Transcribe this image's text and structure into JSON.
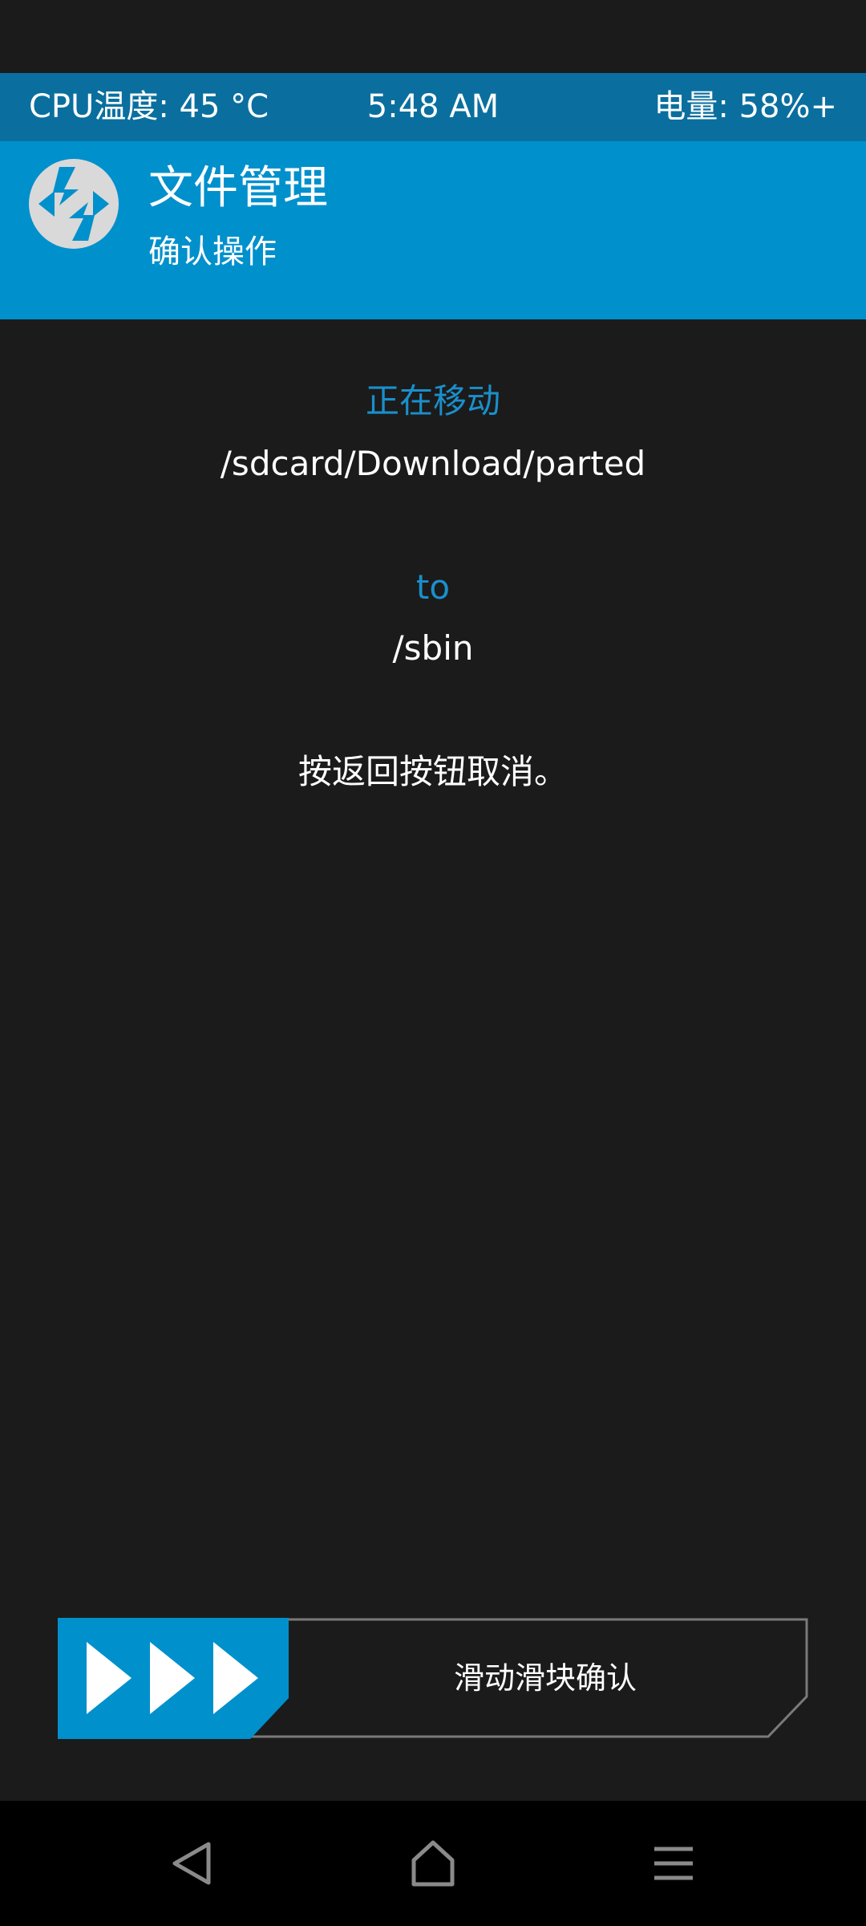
{
  "status_bar": {
    "cpu": "CPU温度: 45 °C",
    "time": "5:48 AM",
    "battery": "电量: 58%+"
  },
  "header": {
    "title": "文件管理",
    "subtitle": "确认操作",
    "logo_icon": "twrp-logo-icon"
  },
  "content": {
    "action_label": "正在移动",
    "source_path": "/sdcard/Download/parted",
    "to_label": "to",
    "dest_path": "/sbin",
    "cancel_hint": "按返回按钮取消。"
  },
  "slider": {
    "label": "滑动滑块确认",
    "handle_icon": "triple-arrow-right-icon"
  },
  "navbar": {
    "back_icon": "back-triangle-icon",
    "home_icon": "home-icon",
    "menu_icon": "menu-icon"
  },
  "colors": {
    "accent": "#0090cc",
    "status_bar": "#0a6f9f",
    "background": "#1b1b1b",
    "text_blue": "#1a8fcb"
  }
}
